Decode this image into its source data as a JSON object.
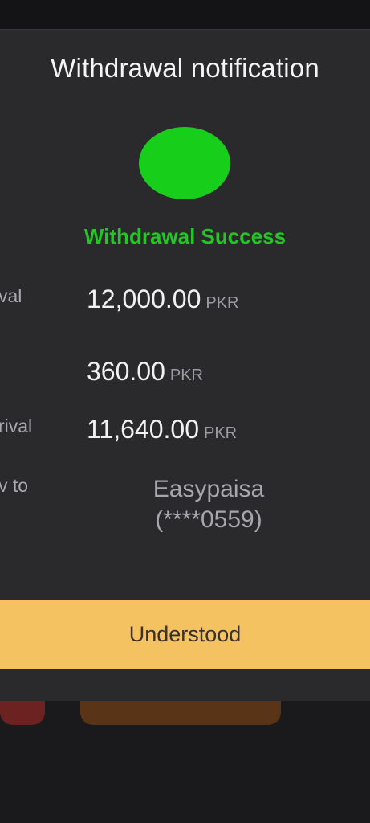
{
  "modal": {
    "title": "Withdrawal notification",
    "status": "Withdrawal Success",
    "status_color": "#17cf1b"
  },
  "rows": [
    {
      "label": "val",
      "amount": "12,000.00",
      "unit": "PKR"
    },
    {
      "label": "",
      "amount": "360.00",
      "unit": "PKR"
    },
    {
      "label": "rival",
      "amount": "11,640.00",
      "unit": "PKR"
    }
  ],
  "method": {
    "label": "v to",
    "name": "Easypaisa",
    "account": "(****0559)"
  },
  "button": {
    "label": "Understood",
    "color": "#f4c261"
  }
}
